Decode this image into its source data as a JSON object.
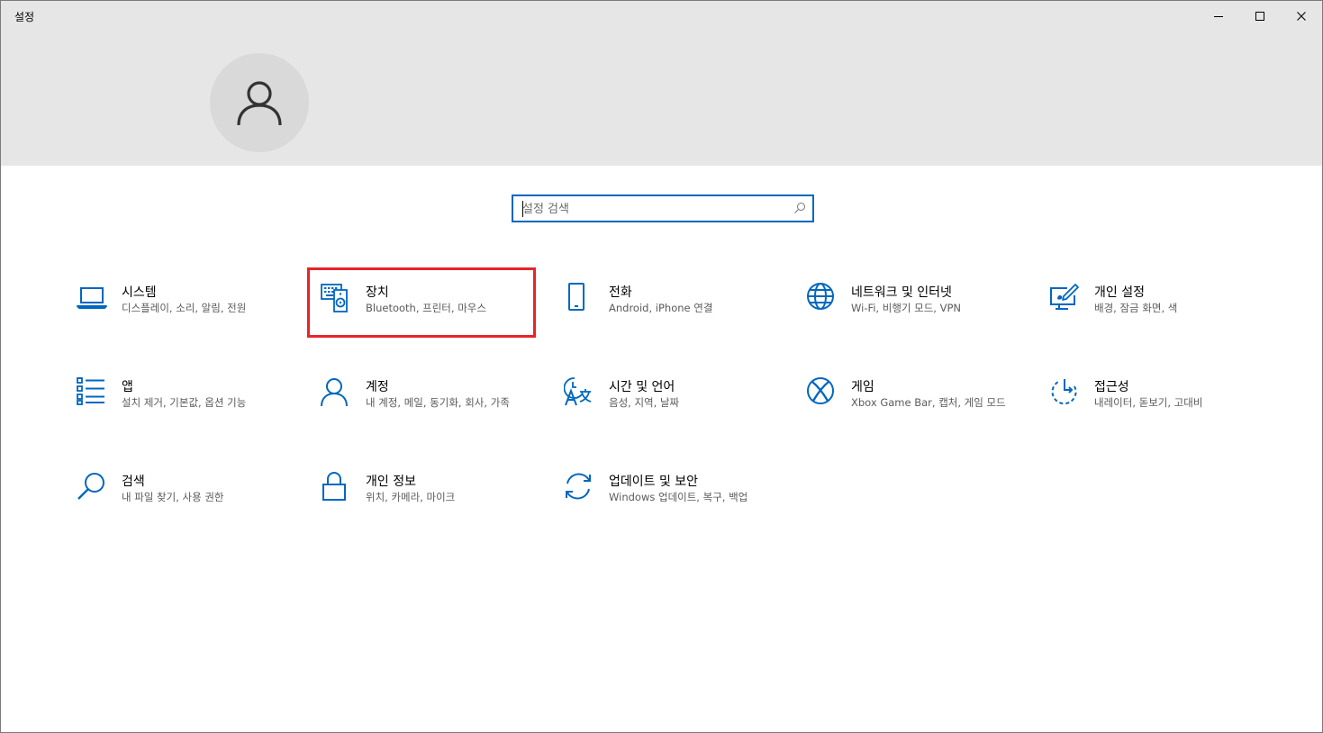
{
  "window": {
    "title": "설정"
  },
  "search": {
    "placeholder": "설정 검색"
  },
  "tiles": [
    {
      "id": "system",
      "name": "시스템",
      "desc": "디스플레이, 소리, 알림, 전원",
      "icon": "laptop-icon"
    },
    {
      "id": "devices",
      "name": "장치",
      "desc": "Bluetooth, 프린터, 마우스",
      "icon": "devices-icon"
    },
    {
      "id": "phone",
      "name": "전화",
      "desc": "Android, iPhone 연결",
      "icon": "phone-icon"
    },
    {
      "id": "network",
      "name": "네트워크 및 인터넷",
      "desc": "Wi-Fi, 비행기 모드, VPN",
      "icon": "globe-icon"
    },
    {
      "id": "personalization",
      "name": "개인 설정",
      "desc": "배경, 잠금 화면, 색",
      "icon": "personalization-icon"
    },
    {
      "id": "apps",
      "name": "앱",
      "desc": "설치 제거, 기본값, 옵션 기능",
      "icon": "apps-list-icon"
    },
    {
      "id": "accounts",
      "name": "계정",
      "desc": "내 계정, 메일, 동기화, 회사, 가족",
      "icon": "person-icon"
    },
    {
      "id": "time-language",
      "name": "시간 및 언어",
      "desc": "음성, 지역, 날짜",
      "icon": "time-language-icon"
    },
    {
      "id": "gaming",
      "name": "게임",
      "desc": "Xbox Game Bar, 캡처, 게임 모드",
      "icon": "xbox-icon"
    },
    {
      "id": "ease-of-access",
      "name": "접근성",
      "desc": "내레이터, 돋보기, 고대비",
      "icon": "ease-of-access-icon"
    },
    {
      "id": "search",
      "name": "검색",
      "desc": "내 파일 찾기, 사용 권한",
      "icon": "magnifier-icon"
    },
    {
      "id": "privacy",
      "name": "개인 정보",
      "desc": "위치, 카메라, 마이크",
      "icon": "lock-icon"
    },
    {
      "id": "update-security",
      "name": "업데이트 및 보안",
      "desc": "Windows 업데이트, 복구, 백업",
      "icon": "sync-icon"
    }
  ],
  "colors": {
    "accent": "#0067c0",
    "highlight": "#e8242a",
    "header_bg": "#e6e6e6"
  }
}
